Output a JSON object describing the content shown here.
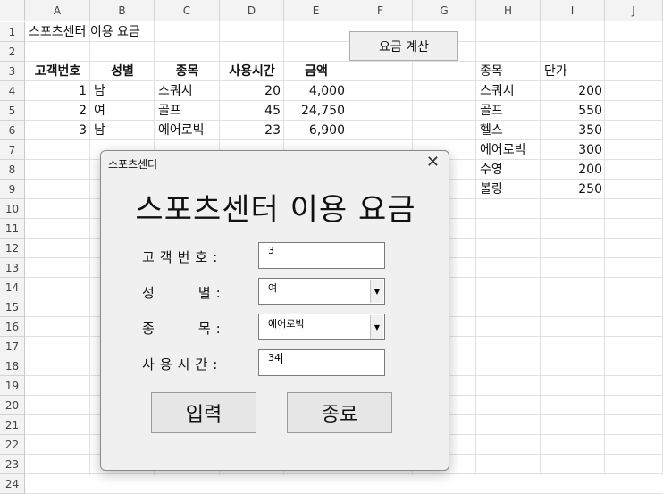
{
  "columns": [
    "A",
    "B",
    "C",
    "D",
    "E",
    "F",
    "G",
    "H",
    "I",
    "J"
  ],
  "rows": [
    "1",
    "2",
    "3",
    "4",
    "5",
    "6",
    "7",
    "8",
    "9",
    "10",
    "11",
    "12",
    "13",
    "14",
    "15",
    "16",
    "17",
    "18",
    "19",
    "20",
    "21",
    "22",
    "23",
    "24"
  ],
  "sheet": {
    "title": "스포츠센터 이용 요금",
    "headers": [
      "고객번호",
      "성별",
      "종목",
      "사용시간",
      "금액"
    ],
    "records": [
      [
        "1",
        "남",
        "스쿼시",
        "20",
        "4,000"
      ],
      [
        "2",
        "여",
        "골프",
        "45",
        "24,750"
      ],
      [
        "3",
        "남",
        "에어로빅",
        "23",
        "6,900"
      ]
    ],
    "price_headers": [
      "종목",
      "단가"
    ],
    "prices": [
      [
        "스쿼시",
        "200"
      ],
      [
        "골프",
        "550"
      ],
      [
        "헬스",
        "350"
      ],
      [
        "에어로빅",
        "300"
      ],
      [
        "수영",
        "200"
      ],
      [
        "볼링",
        "250"
      ]
    ],
    "calc_button": "요금 계산"
  },
  "dialog": {
    "window_title": "스포츠센터",
    "close_glyph": "✕",
    "heading": "스포츠센터 이용 요금",
    "labels": {
      "customer_no": "고객번호:",
      "gender": "성    별:",
      "sport": "종    목:",
      "usage_time": "사용시간:"
    },
    "values": {
      "customer_no": "3",
      "gender": "여",
      "sport": "에어로빅",
      "usage_time": "34"
    },
    "dropdown_glyph": "▼",
    "input_button": "입력",
    "exit_button": "종료"
  }
}
